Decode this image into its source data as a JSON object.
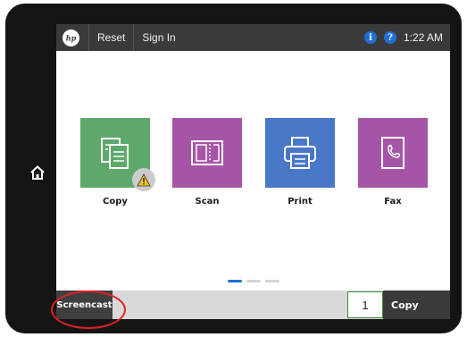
{
  "topbar": {
    "reset_label": "Reset",
    "signin_label": "Sign In",
    "time": "1:22 AM",
    "info_glyph": "i",
    "help_glyph": "?"
  },
  "apps": [
    {
      "label": "Copy",
      "color": "#5fa86b",
      "icon": "copy-icon",
      "warning": true
    },
    {
      "label": "Scan",
      "color": "#a655a6",
      "icon": "scan-icon"
    },
    {
      "label": "Print",
      "color": "#4a78c9",
      "icon": "print-icon"
    },
    {
      "label": "Fax",
      "color": "#a655a6",
      "icon": "fax-icon"
    }
  ],
  "pager": {
    "pages": 3,
    "active": 1
  },
  "bottombar": {
    "screencast_label": "Screencast",
    "quantity": "1",
    "copy_label": "Copy"
  },
  "colors": {
    "accent": "#1f6fd6",
    "highlight": "#e02020",
    "topbar": "#3a3a3a"
  }
}
